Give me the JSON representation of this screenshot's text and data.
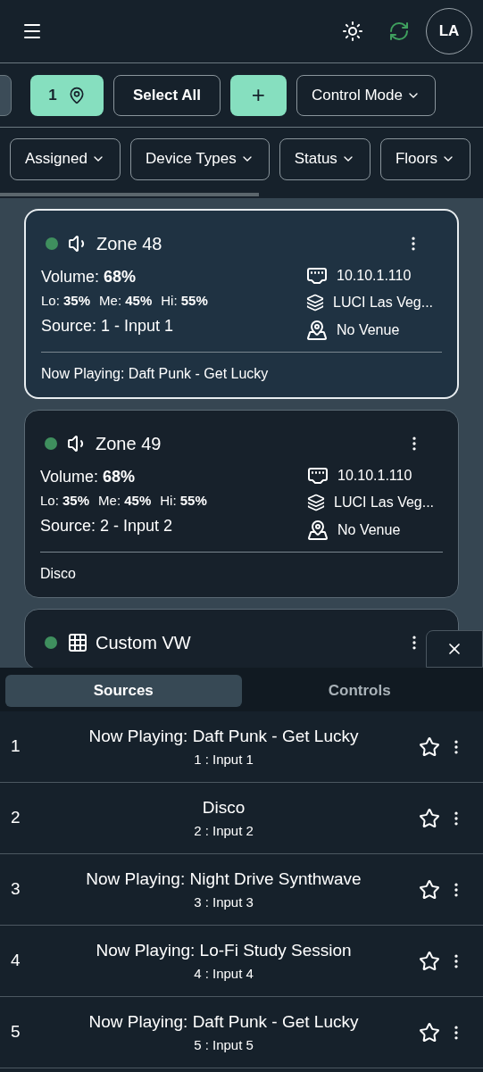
{
  "header": {
    "avatar": "LA"
  },
  "toolbar": {
    "location_count": "1",
    "select_all": "Select All",
    "add": "+",
    "control_mode": "Control Mode"
  },
  "filters": [
    {
      "label": "Assigned"
    },
    {
      "label": "Device Types"
    },
    {
      "label": "Status"
    },
    {
      "label": "Floors"
    }
  ],
  "zones": [
    {
      "name": "Zone 48",
      "kind": "speaker",
      "selected": true,
      "color": "#3f8f5e",
      "volume": "Volume: **68%**",
      "eq": [
        "Lo: **35%**",
        "Me: **45%**",
        "Hi: **55%**"
      ],
      "source": "Source: 1 - Input 1",
      "ip": "10.10.1.110",
      "location": "LUCI Las Veg...",
      "venue": "No Venue",
      "now_playing": "Now Playing: Daft Punk - Get Lucky"
    },
    {
      "name": "Zone 49",
      "kind": "speaker",
      "selected": false,
      "color": "#3f8f5e",
      "volume": "Volume: **68%**",
      "eq": [
        "Lo: **35%**",
        "Me: **45%**",
        "Hi: **55%**"
      ],
      "source": "Source: 2 - Input 2",
      "ip": "10.10.1.110",
      "location": "LUCI Las Veg...",
      "venue": "No Venue",
      "now_playing": "Disco"
    },
    {
      "name": "Custom VW",
      "kind": "videowall",
      "selected": false,
      "color": "#3f8f5e"
    }
  ],
  "sheet": {
    "tabs": [
      {
        "label": "Sources",
        "selected": true
      },
      {
        "label": "Controls",
        "selected": false
      }
    ],
    "sources": [
      {
        "number": "1",
        "title": "Now Playing: Daft Punk - Get Lucky",
        "subtitle": "1 : Input 1",
        "favorite": false
      },
      {
        "number": "2",
        "title": "Disco",
        "subtitle": "2 : Input 2",
        "favorite": false
      },
      {
        "number": "3",
        "title": "Now Playing: Night Drive Synthwave",
        "subtitle": "3 : Input 3",
        "favorite": false
      },
      {
        "number": "4",
        "title": "Now Playing: Lo-Fi Study Session",
        "subtitle": "4 : Input 4",
        "favorite": false
      },
      {
        "number": "5",
        "title": "Now Playing: Daft Punk - Get Lucky",
        "subtitle": "5 : Input 5",
        "favorite": false
      }
    ]
  }
}
